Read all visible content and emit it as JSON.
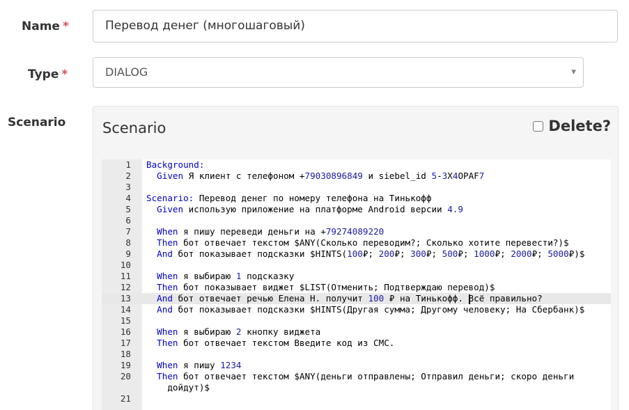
{
  "form": {
    "name_label": "Name",
    "type_label": "Type",
    "scenario_label": "Scenario",
    "required_mark": "*",
    "name_value": "Перевод денег (многошаговый)",
    "type_value": "DIALOG"
  },
  "panel": {
    "title": "Scenario",
    "delete_label": "Delete?"
  },
  "editor": {
    "active_line": 13,
    "lines": [
      {
        "n": "1",
        "seg": [
          [
            "kw",
            "Background:"
          ]
        ]
      },
      {
        "n": "2",
        "seg": [
          [
            "",
            "  "
          ],
          [
            "kw",
            "Given"
          ],
          [
            "",
            " Я клиент с телефоном +"
          ],
          [
            "num",
            "79030896849"
          ],
          [
            "",
            " и siebel_id "
          ],
          [
            "num",
            "5"
          ],
          [
            "",
            "-"
          ],
          [
            "num",
            "3"
          ],
          [
            "",
            "X"
          ],
          [
            "num",
            "4"
          ],
          [
            "",
            "OPAF"
          ],
          [
            "num",
            "7"
          ]
        ]
      },
      {
        "n": "3",
        "seg": []
      },
      {
        "n": "4",
        "seg": [
          [
            "kw",
            "Scenario:"
          ],
          [
            "",
            " Перевод денег по номеру телефона на Тинькофф"
          ]
        ]
      },
      {
        "n": "5",
        "seg": [
          [
            "",
            "  "
          ],
          [
            "kw",
            "Given"
          ],
          [
            "",
            " использую приложение на платформе Android версии "
          ],
          [
            "num",
            "4.9"
          ]
        ]
      },
      {
        "n": "6",
        "seg": []
      },
      {
        "n": "7",
        "seg": [
          [
            "",
            "  "
          ],
          [
            "kw",
            "When"
          ],
          [
            "",
            " я пишу переведи деньги на +"
          ],
          [
            "num",
            "79274089220"
          ]
        ]
      },
      {
        "n": "8",
        "seg": [
          [
            "",
            "  "
          ],
          [
            "kw",
            "Then"
          ],
          [
            "",
            " бот отвечает текстом $ANY(Сколько переводим?; Сколько хотите перевести?)$"
          ]
        ]
      },
      {
        "n": "9",
        "seg": [
          [
            "",
            "  "
          ],
          [
            "kw",
            "And"
          ],
          [
            "",
            " бот показывает подсказки $HINTS("
          ],
          [
            "num",
            "100"
          ],
          [
            "",
            "₽; "
          ],
          [
            "num",
            "200"
          ],
          [
            "",
            "₽; "
          ],
          [
            "num",
            "300"
          ],
          [
            "",
            "₽; "
          ],
          [
            "num",
            "500"
          ],
          [
            "",
            "₽; "
          ],
          [
            "num",
            "1000"
          ],
          [
            "",
            "₽; "
          ],
          [
            "num",
            "2000"
          ],
          [
            "",
            "₽; "
          ],
          [
            "num",
            "5000"
          ],
          [
            "",
            "₽)$"
          ]
        ]
      },
      {
        "n": "10",
        "seg": []
      },
      {
        "n": "11",
        "seg": [
          [
            "",
            "  "
          ],
          [
            "kw",
            "When"
          ],
          [
            "",
            " я выбираю "
          ],
          [
            "num",
            "1"
          ],
          [
            "",
            " подсказку"
          ]
        ]
      },
      {
        "n": "12",
        "seg": [
          [
            "",
            "  "
          ],
          [
            "kw",
            "Then"
          ],
          [
            "",
            " бот показывает виджет $LIST(Отменить; Подтверждаю перевод)$"
          ]
        ]
      },
      {
        "n": "13",
        "seg": [
          [
            "",
            "  "
          ],
          [
            "kw",
            "And"
          ],
          [
            "",
            " бот отвечает речью Елена Н. получит "
          ],
          [
            "num",
            "100"
          ],
          [
            "",
            " ₽ на Тинькофф. "
          ],
          [
            "cursor",
            ""
          ],
          [
            "",
            "Всё правильно?"
          ]
        ]
      },
      {
        "n": "14",
        "seg": [
          [
            "",
            "  "
          ],
          [
            "kw",
            "And"
          ],
          [
            "",
            " бот показывает подсказки $HINTS(Другая сумма; Другому человеку; На Сбербанк)$"
          ]
        ]
      },
      {
        "n": "15",
        "seg": []
      },
      {
        "n": "16",
        "seg": [
          [
            "",
            "  "
          ],
          [
            "kw",
            "When"
          ],
          [
            "",
            " я выбираю "
          ],
          [
            "num",
            "2"
          ],
          [
            "",
            " кнопку виджета"
          ]
        ]
      },
      {
        "n": "17",
        "seg": [
          [
            "",
            "  "
          ],
          [
            "kw",
            "Then"
          ],
          [
            "",
            " бот отвечает текстом Введите код из СМС."
          ]
        ]
      },
      {
        "n": "18",
        "seg": []
      },
      {
        "n": "19",
        "seg": [
          [
            "",
            "  "
          ],
          [
            "kw",
            "When"
          ],
          [
            "",
            " я пишу "
          ],
          [
            "num",
            "1234"
          ]
        ]
      },
      {
        "n": "20",
        "seg": [
          [
            "",
            "  "
          ],
          [
            "kw",
            "Then"
          ],
          [
            "",
            " бот отвечает текстом $ANY(деньги отправлены; Отправил деньги; скоро деньги\n    дойдут)$"
          ]
        ],
        "tall": true
      },
      {
        "n": "21",
        "seg": []
      }
    ]
  }
}
